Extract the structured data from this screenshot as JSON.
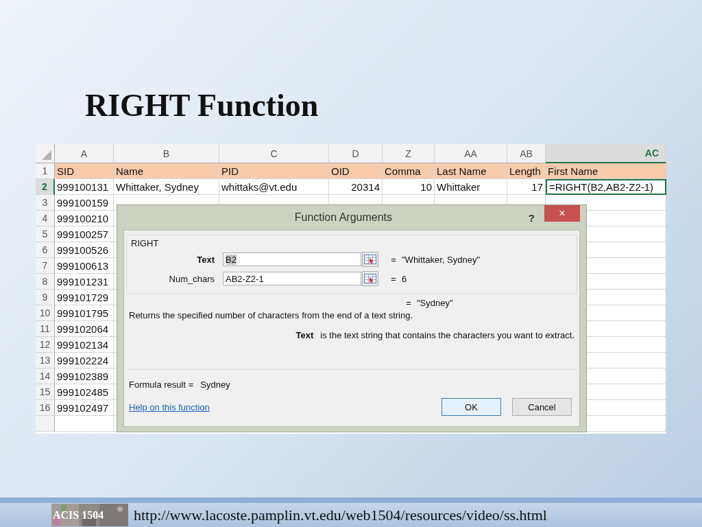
{
  "slide": {
    "title": "RIGHT Function"
  },
  "sheet": {
    "columns": [
      {
        "label": "A",
        "selected": false
      },
      {
        "label": "B",
        "selected": false
      },
      {
        "label": "C",
        "selected": false
      },
      {
        "label": "D",
        "selected": false
      },
      {
        "label": "Z",
        "selected": false
      },
      {
        "label": "AA",
        "selected": false
      },
      {
        "label": "AB",
        "selected": false
      },
      {
        "label": "AC",
        "selected": true
      }
    ],
    "rows": [
      {
        "label": "1",
        "selected": false,
        "kind": "header",
        "cells": [
          "SID",
          "Name",
          "PID",
          "OID",
          "Comma",
          "Last Name",
          "Length",
          "First Name"
        ]
      },
      {
        "label": "2",
        "selected": true,
        "kind": "data",
        "cells": [
          "999100131",
          "Whittaker, Sydney",
          "whittaks@vt.edu",
          "20314",
          "10",
          "Whittaker",
          "17",
          "=RIGHT(B2,AB2-Z2-1)"
        ]
      },
      {
        "label": "3",
        "selected": false,
        "kind": "data",
        "cells": [
          "999100159"
        ]
      },
      {
        "label": "4",
        "selected": false,
        "kind": "data",
        "cells": [
          "999100210"
        ]
      },
      {
        "label": "5",
        "selected": false,
        "kind": "data",
        "cells": [
          "999100257"
        ]
      },
      {
        "label": "6",
        "selected": false,
        "kind": "data",
        "cells": [
          "999100526"
        ]
      },
      {
        "label": "7",
        "selected": false,
        "kind": "data",
        "cells": [
          "999100613"
        ]
      },
      {
        "label": "8",
        "selected": false,
        "kind": "data",
        "cells": [
          "999101231"
        ]
      },
      {
        "label": "9",
        "selected": false,
        "kind": "data",
        "cells": [
          "999101729"
        ]
      },
      {
        "label": "10",
        "selected": false,
        "kind": "data",
        "cells": [
          "999101795"
        ]
      },
      {
        "label": "11",
        "selected": false,
        "kind": "data",
        "cells": [
          "999102064"
        ]
      },
      {
        "label": "12",
        "selected": false,
        "kind": "data",
        "cells": [
          "999102134"
        ]
      },
      {
        "label": "13",
        "selected": false,
        "kind": "data",
        "cells": [
          "999102224"
        ]
      },
      {
        "label": "14",
        "selected": false,
        "kind": "data",
        "cells": [
          "999102389"
        ]
      },
      {
        "label": "15",
        "selected": false,
        "kind": "data",
        "cells": [
          "999102485"
        ]
      },
      {
        "label": "16",
        "selected": false,
        "kind": "data",
        "cells": [
          "999102497"
        ]
      }
    ]
  },
  "dialog": {
    "title": "Function Arguments",
    "help_glyph": "?",
    "close_glyph": "×",
    "function_name": "RIGHT",
    "arguments": [
      {
        "label": "Text",
        "focused": true,
        "value": "B2",
        "equals": "=",
        "result": "\"Whittaker, Sydney\""
      },
      {
        "label": "Num_chars",
        "focused": false,
        "value": "AB2-Z2-1",
        "equals": "=",
        "result": "6"
      }
    ],
    "function_result": {
      "equals": "=",
      "value": "\"Sydney\""
    },
    "description": "Returns the specified number of characters from the end of a text string.",
    "argument_help": {
      "name": "Text",
      "text": "is the text string that contains the characters you want to extract."
    },
    "formula_result": {
      "label": "Formula result =",
      "value": "Sydney"
    },
    "help_link": "Help on this function",
    "buttons": [
      {
        "label": "OK",
        "default": true
      },
      {
        "label": "Cancel",
        "default": false
      }
    ]
  },
  "footer": {
    "logo": "ACIS 1504",
    "url": "http://www.lacoste.pamplin.vt.edu/web1504/resources/video/ss.html"
  }
}
